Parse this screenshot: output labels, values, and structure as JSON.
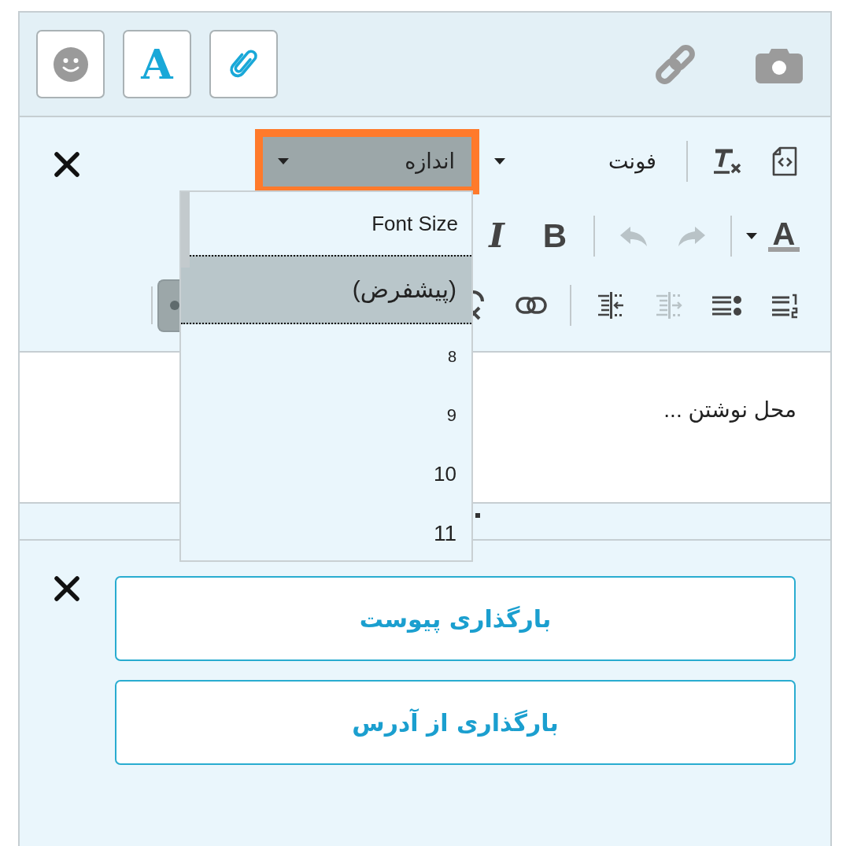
{
  "media_bar": {
    "buttons": [
      {
        "kind": "emoji"
      },
      {
        "kind": "font",
        "glyph": "A"
      },
      {
        "kind": "attach"
      }
    ],
    "actions": [
      {
        "kind": "link"
      },
      {
        "kind": "camera"
      }
    ]
  },
  "editor": {
    "toolbar": {
      "rows": [
        {
          "items": [
            {
              "kind": "source",
              "disabled": false
            },
            {
              "kind": "clear-format",
              "disabled": false
            },
            {
              "kind": "separator"
            },
            {
              "kind": "combo",
              "label": "فونت",
              "expanded": false,
              "disabled": false
            },
            {
              "kind": "combo",
              "label": "اندازه",
              "expanded": true,
              "disabled": false
            }
          ]
        },
        {
          "items": [
            {
              "kind": "text-color",
              "glyph": "A",
              "disabled": false
            },
            {
              "kind": "separator"
            },
            {
              "kind": "redo",
              "disabled": true
            },
            {
              "kind": "undo",
              "disabled": true
            },
            {
              "kind": "separator"
            },
            {
              "kind": "bold",
              "glyph": "B",
              "disabled": false
            },
            {
              "kind": "italic",
              "glyph": "I",
              "disabled": false
            }
          ]
        },
        {
          "items": [
            {
              "kind": "numbered-list",
              "disabled": false
            },
            {
              "kind": "bulleted-list",
              "disabled": false
            },
            {
              "kind": "indent",
              "disabled": true
            },
            {
              "kind": "outdent",
              "disabled": false
            },
            {
              "kind": "separator"
            },
            {
              "kind": "link",
              "disabled": false
            },
            {
              "kind": "unlink",
              "disabled": false
            }
          ],
          "end_items": [
            {
              "kind": "toggle",
              "on": true,
              "disabled": false
            },
            {
              "kind": "separator"
            }
          ]
        }
      ]
    },
    "placeholder": "محل نوشتن ..."
  },
  "size_menu": {
    "title": "Font Size",
    "options": [
      {
        "label": "(پیشفرض)",
        "selected": true
      },
      {
        "label": "8",
        "selected": false
      },
      {
        "label": "9",
        "selected": false
      },
      {
        "label": "10",
        "selected": false
      },
      {
        "label": "11",
        "selected": false
      }
    ]
  },
  "upload_panel": {
    "buttons": [
      {
        "label": "بارگذاری پیوست"
      },
      {
        "label": "بارگذاری از آدرس"
      }
    ]
  }
}
